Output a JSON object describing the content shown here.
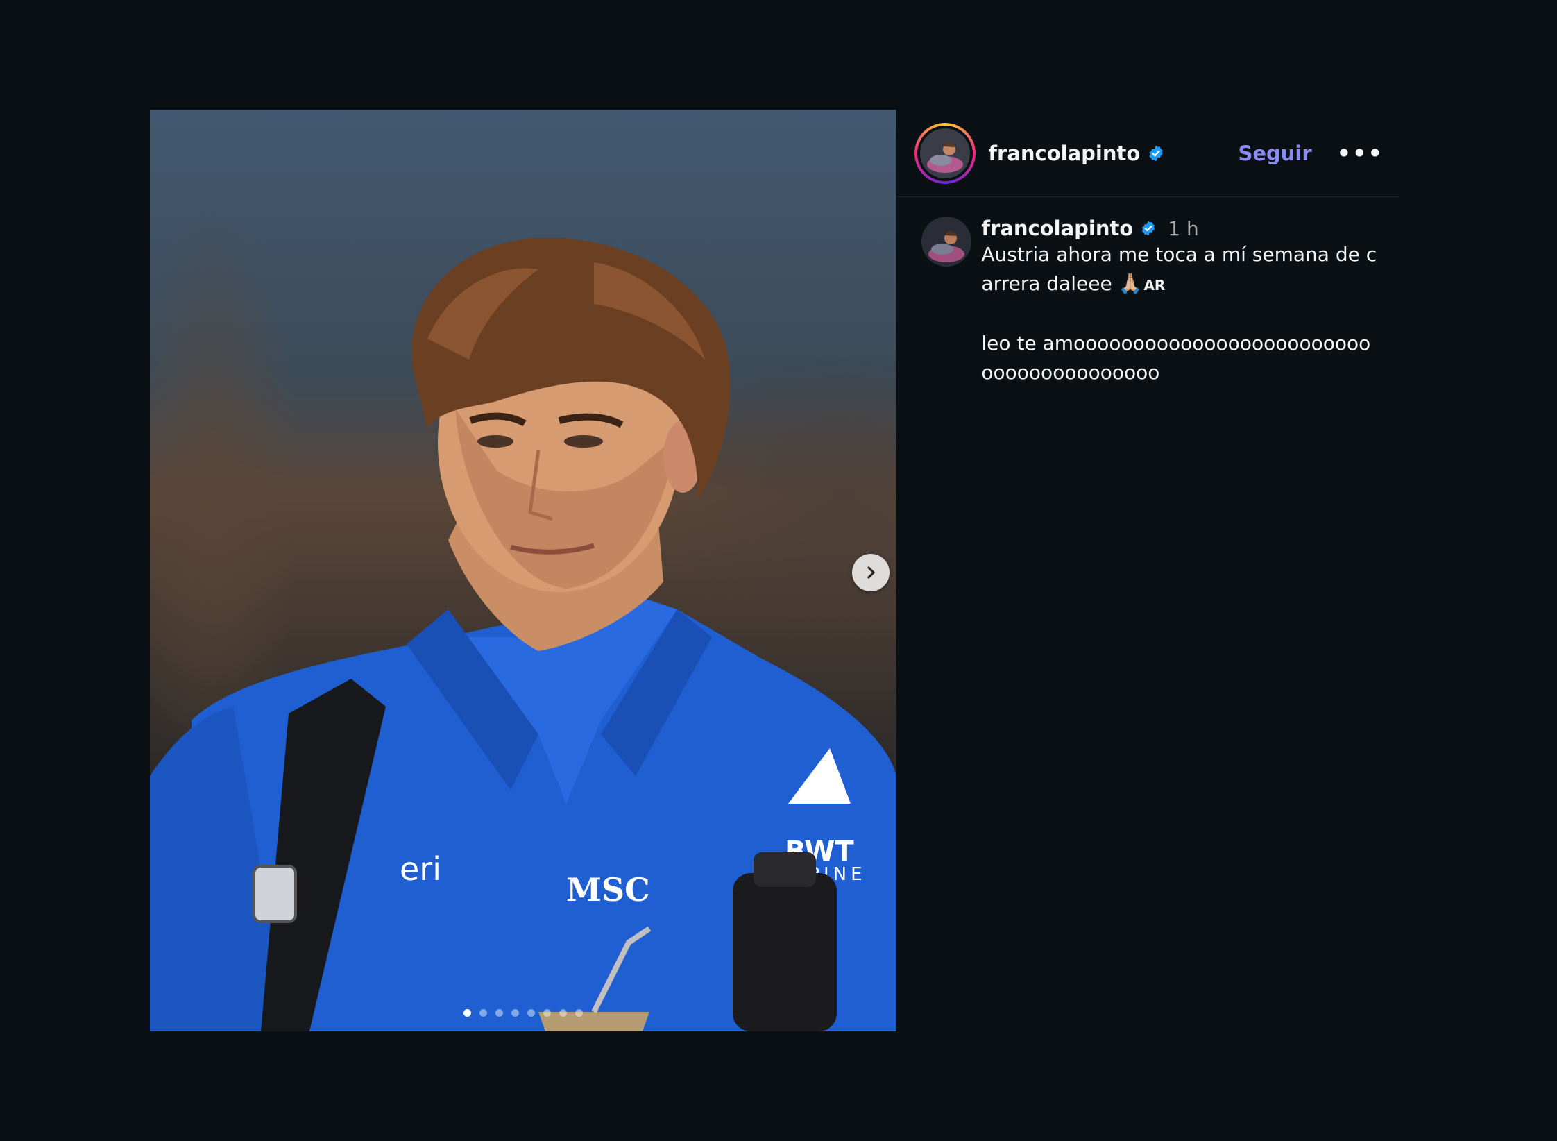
{
  "post": {
    "username": "francolapinto",
    "follow_label": "Seguir",
    "more_label": "•••",
    "caption": {
      "username": "francolapinto",
      "time": "1 h",
      "line1": "Austria ahora me toca a mí semana de carrera daleee",
      "emoji": "🙏🏼",
      "flag_code": "AR",
      "line2": "leo te amoooooooooooooooooooooooooooooooooooooooo"
    },
    "carousel": {
      "slide_count": 8,
      "active_index": 0
    }
  },
  "colors": {
    "background": "#0b1014",
    "follow_accent": "#8a8cf3",
    "verified": "#1d9bf0"
  }
}
